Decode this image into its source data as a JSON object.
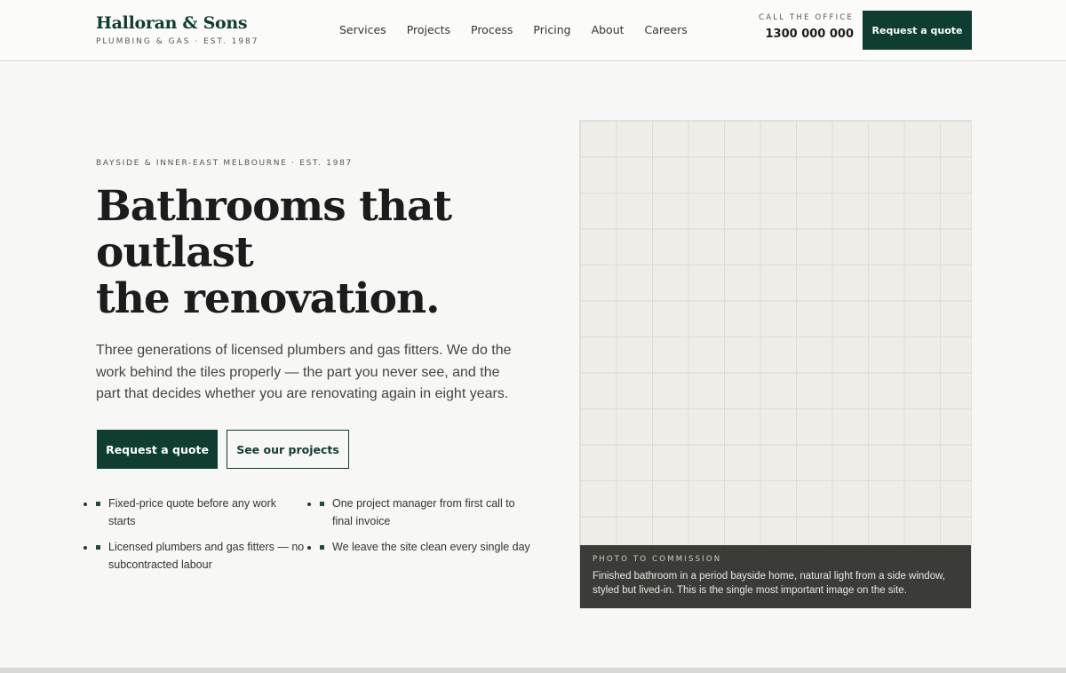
{
  "header": {
    "brand_name": "Halloran & Sons",
    "brand_tagline": "PLUMBING & GAS · EST. 1987",
    "nav": [
      "Services",
      "Projects",
      "Process",
      "Pricing",
      "About",
      "Careers"
    ],
    "call_label": "CALL THE OFFICE",
    "call_number": "1300 000 000",
    "cta_label": "Request a quote"
  },
  "hero": {
    "eyebrow": "BAYSIDE & INNER-EAST MELBOURNE · EST. 1987",
    "headline_lines": [
      "Bathrooms that",
      "outlast",
      "the renovation."
    ],
    "lede": "Three generations of licensed plumbers and gas fitters. We do the work behind the tiles properly — the part you never see, and the part that decides whether you are renovating again in eight years.",
    "primary_cta": "Request a quote",
    "secondary_cta": "See our projects",
    "features": [
      "Fixed-price quote before any work starts",
      "One project manager from first call to final invoice",
      "Licensed plumbers and gas fitters — no subcontracted labour",
      "We leave the site clean every single day"
    ]
  },
  "photo": {
    "caption_label": "PHOTO TO COMMISSION",
    "caption_text": "Finished bathroom in a period bayside home, natural light from a side window, styled but lived-in. This is the single most important image on the site."
  },
  "colors": {
    "brand_green": "#0f3d31",
    "background": "#f7f7f5",
    "caption_bg": "#3b3b37"
  }
}
